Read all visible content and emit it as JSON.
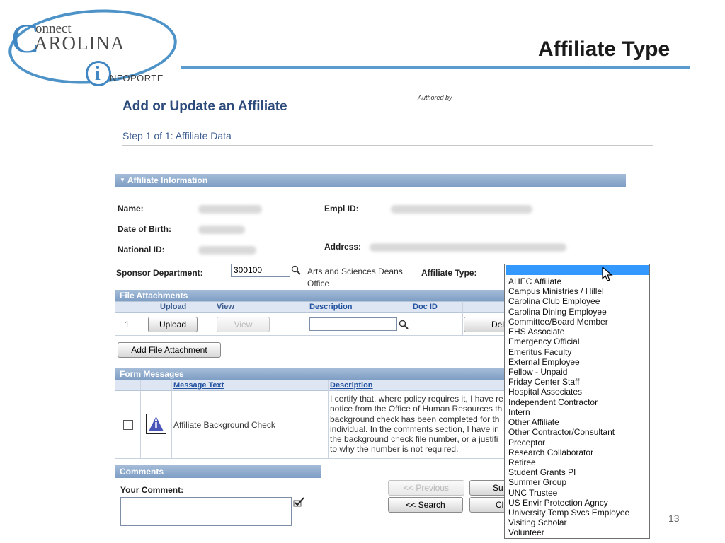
{
  "logo": {
    "c": "C",
    "onnect": "onnect",
    "arolina": "AROLINA",
    "i": "i",
    "infoporte": "NFOPORTE"
  },
  "slide_title": "Affiliate Type",
  "authored_by": "Authored by",
  "page": {
    "heading": "Add or Update an Affiliate",
    "step": "Step 1 of 1: Affiliate  Data"
  },
  "affiliate_info": {
    "section_title": "Affiliate Information",
    "name_label": "Name:",
    "dob_label": "Date of Birth:",
    "national_id_label": "National ID:",
    "empl_id_label": "Empl ID:",
    "address_label": "Address:",
    "sponsor_label": "Sponsor Department:",
    "sponsor_value": "300100",
    "sponsor_desc_1": "Arts and Sciences Deans",
    "sponsor_desc_2": "Office",
    "affiliate_type_label": "Affiliate Type:"
  },
  "file_attachments": {
    "section_title": "File Attachments",
    "col_upload": "Upload",
    "col_view": "View",
    "col_description": "Description",
    "col_docid": "Doc ID",
    "row_num": "1",
    "upload_btn": "Upload",
    "view_btn": "View",
    "delete_btn_partial": "Del",
    "add_btn": "Add File Attachment"
  },
  "form_messages": {
    "section_title": "Form Messages",
    "col_message": "Message Text",
    "col_description": "Description",
    "message_text": "Affiliate Background Check",
    "description_lines": [
      "I certify that, where policy requires it, I have re",
      "notice from the Office of Human Resources th",
      "background check has been completed for th",
      "individual.  In the comments section, I have in",
      "the background check file number, or a justifi",
      "to why the number is not required."
    ]
  },
  "comments": {
    "section_title": "Comments",
    "your_comment_label": "Your Comment:"
  },
  "nav_buttons": {
    "previous": "<< Previous",
    "search": "<< Search",
    "submit_partial": "Su",
    "clear_partial": "Cl"
  },
  "affiliate_type_options": [
    "AHEC Affiliate",
    "Campus Ministries / Hillel",
    "Carolina Club Employee",
    "Carolina Dining Employee",
    "Committee/Board Member",
    "EHS Associate",
    "Emergency Official",
    "Emeritus Faculty",
    "External Employee",
    "Fellow - Unpaid",
    "Friday Center Staff",
    "Hospital Associates",
    "Independent Contractor",
    "Intern",
    "Other Affiliate",
    "Other Contractor/Consultant",
    "Preceptor",
    "Research Collaborator",
    "Retiree",
    "Student Grants PI",
    "Summer Group",
    "UNC Trustee",
    "US Envir Protection Agncy",
    "University Temp Svcs Employee",
    "Visiting Scholar",
    "Volunteer"
  ],
  "slide_number": "13",
  "colors": {
    "accent": "#3f86c2",
    "section_bar": "#8aa6ca",
    "selected": "#3399ff"
  }
}
